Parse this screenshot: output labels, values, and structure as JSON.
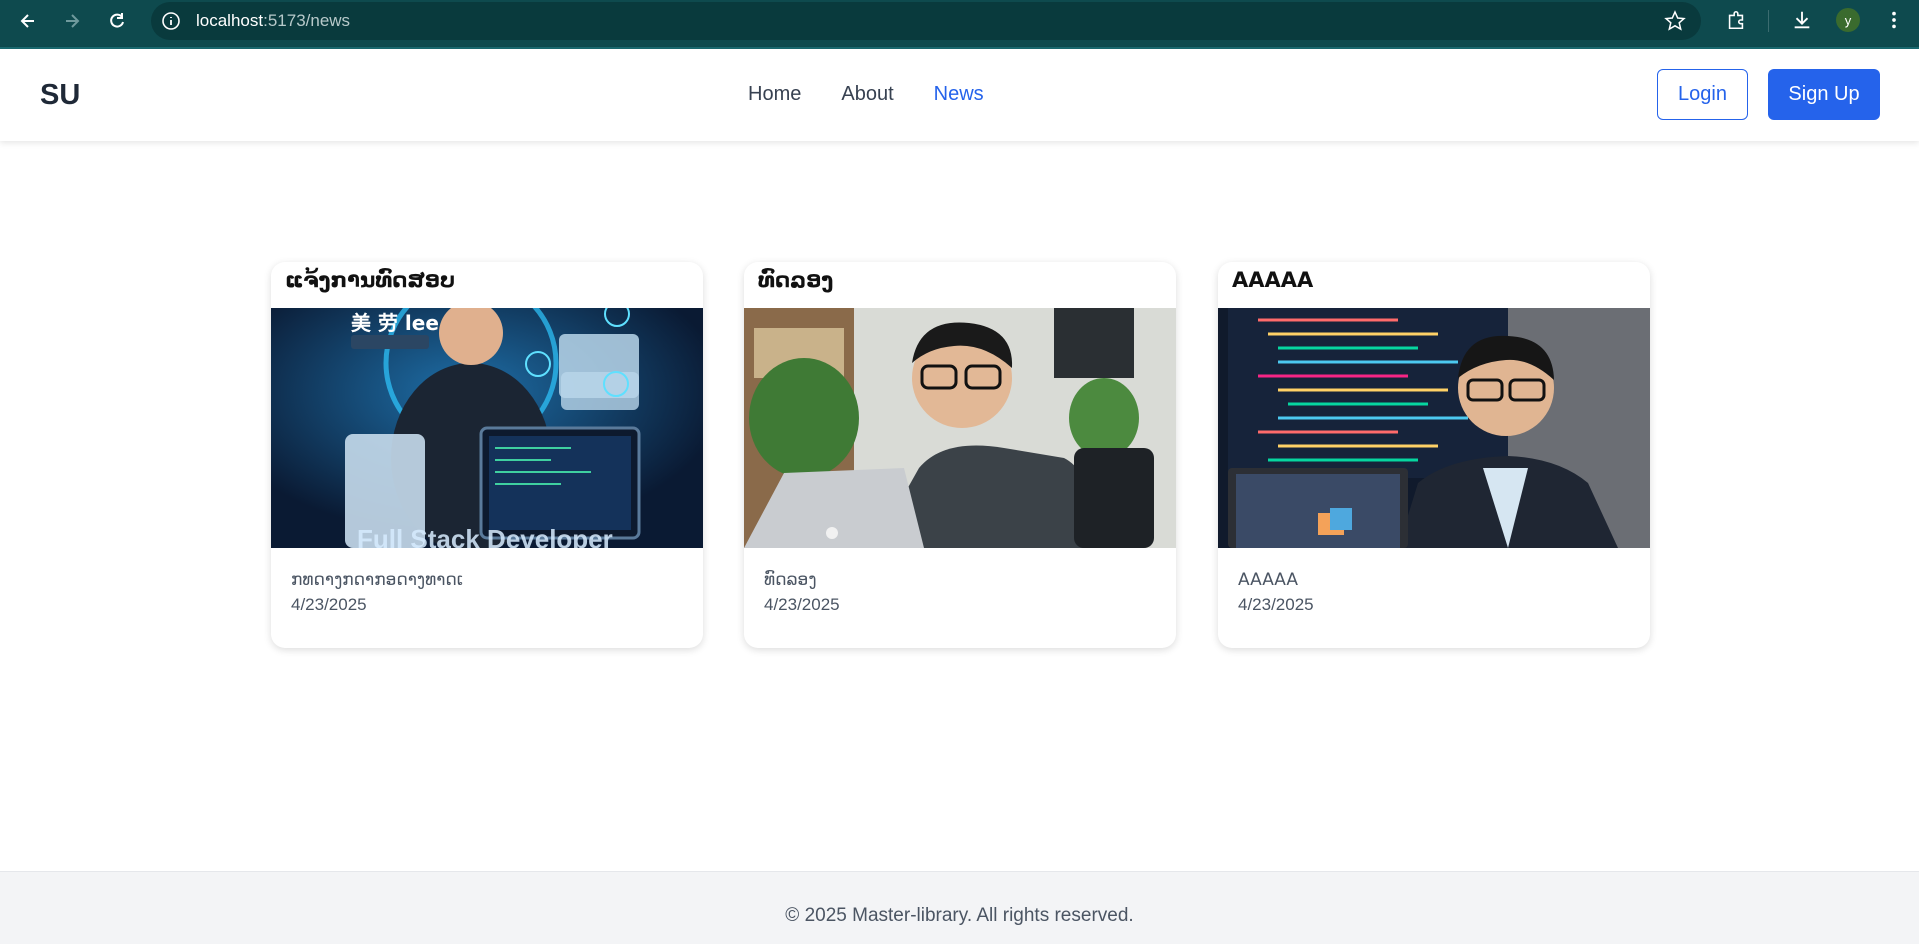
{
  "browser": {
    "url_host": "localhost",
    "url_path": ":5173/news",
    "profile_initial": "y"
  },
  "header": {
    "logo": "SU",
    "nav": [
      {
        "label": "Home"
      },
      {
        "label": "About"
      },
      {
        "label": "News"
      }
    ],
    "login_label": "Login",
    "signup_label": "Sign Up"
  },
  "cards": [
    {
      "title": "ແຈ້ງການທົດສອບ",
      "image_icon": "developer-portfolio-image",
      "image_text": "Full Stack Developer",
      "description": "ກທດາງກດາກອດາງທາດເ",
      "date": "4/23/2025"
    },
    {
      "title": "ທົດລອງ",
      "image_icon": "developer-at-laptop-image",
      "description": "ທົດລອງ",
      "date": "4/23/2025"
    },
    {
      "title": "AAAAA",
      "image_icon": "developer-with-code-screen-image",
      "description": "AAAAA",
      "date": "4/23/2025"
    }
  ],
  "footer": {
    "copyright": "© 2025 Master-library. All rights reserved."
  },
  "colors": {
    "browser_bar": "#0e4a4e",
    "accent": "#2563eb",
    "footer_bg": "#f3f4f6"
  }
}
